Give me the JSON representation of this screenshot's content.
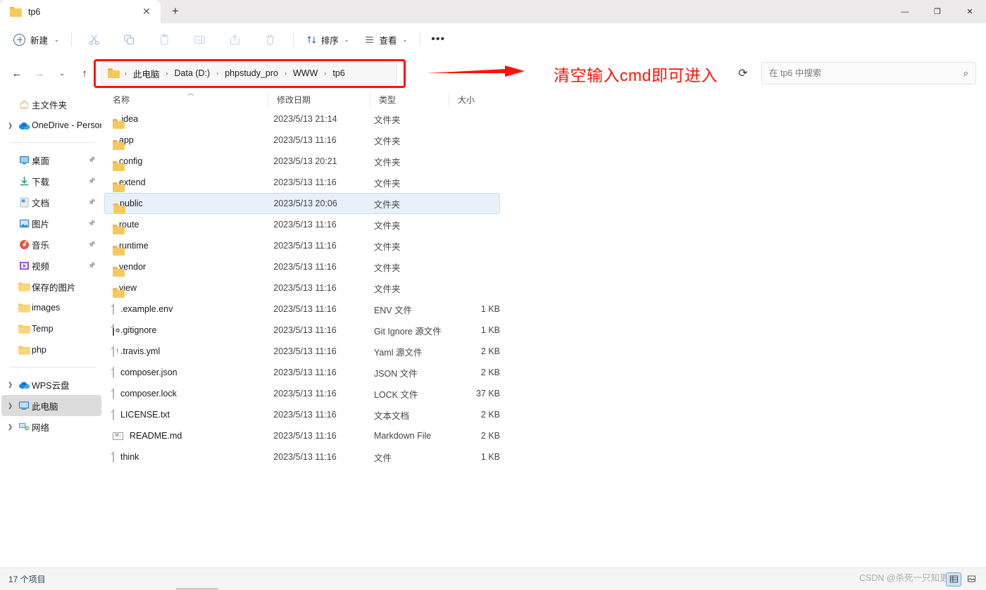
{
  "window": {
    "tab_title": "tp6",
    "tab_close_label": "✕",
    "new_tab_label": "+",
    "minimize_label": "—",
    "restore_label": "❐",
    "close_label": "✕"
  },
  "toolbar": {
    "new_label": "新建",
    "new_chevron": "⌄",
    "cut_label": "剪切",
    "copy_label": "复制",
    "paste_label": "粘贴",
    "rename_label": "重命名",
    "share_label": "共享",
    "delete_label": "删除",
    "sort_label": "排序",
    "sort_chevron": "⌄",
    "view_label": "查看",
    "view_chevron": "⌄",
    "more_label": "•••"
  },
  "navigation": {
    "back_label": "←",
    "forward_label": "→",
    "recent_label": "⌄",
    "up_label": "↑"
  },
  "breadcrumb": {
    "items": [
      "此电脑",
      "Data (D:)",
      "phpstudy_pro",
      "WWW",
      "tp6"
    ],
    "separator": "›"
  },
  "annotation": {
    "text": "清空输入cmd即可进入",
    "color": "#fc1404"
  },
  "search": {
    "placeholder": "在 tp6 中搜索",
    "value": "",
    "icon": "search-icon"
  },
  "refresh": {
    "label": "⟳"
  },
  "sidebar": {
    "items": [
      {
        "label": "主文件夹",
        "icon": "home-icon",
        "chevron": "",
        "pin": false,
        "selected": false
      },
      {
        "label": "OneDrive - Persor",
        "icon": "onedrive-icon",
        "chevron": "›",
        "pin": false,
        "selected": false
      },
      {
        "divider": true
      },
      {
        "label": "桌面",
        "icon": "desktop-icon",
        "chevron": "",
        "pin": true,
        "selected": false
      },
      {
        "label": "下载",
        "icon": "downloads-icon",
        "chevron": "",
        "pin": true,
        "selected": false
      },
      {
        "label": "文档",
        "icon": "documents-icon",
        "chevron": "",
        "pin": true,
        "selected": false
      },
      {
        "label": "图片",
        "icon": "pictures-icon",
        "chevron": "",
        "pin": true,
        "selected": false
      },
      {
        "label": "音乐",
        "icon": "music-icon",
        "chevron": "",
        "pin": true,
        "selected": false
      },
      {
        "label": "视频",
        "icon": "videos-icon",
        "chevron": "",
        "pin": true,
        "selected": false
      },
      {
        "label": "保存的图片",
        "icon": "folder-icon",
        "chevron": "",
        "pin": false,
        "selected": false
      },
      {
        "label": "images",
        "icon": "folder-icon",
        "chevron": "",
        "pin": false,
        "selected": false
      },
      {
        "label": "Temp",
        "icon": "folder-icon",
        "chevron": "",
        "pin": false,
        "selected": false
      },
      {
        "label": "php",
        "icon": "folder-icon",
        "chevron": "",
        "pin": false,
        "selected": false
      },
      {
        "divider": true
      },
      {
        "label": "WPS云盘",
        "icon": "wps-cloud-icon",
        "chevron": "›",
        "pin": false,
        "selected": false
      },
      {
        "label": "此电脑",
        "icon": "this-pc-icon",
        "chevron": "›",
        "pin": false,
        "selected": true
      },
      {
        "label": "网络",
        "icon": "network-icon",
        "chevron": "›",
        "pin": false,
        "selected": false
      }
    ]
  },
  "filelist": {
    "columns": [
      "名称",
      "修改日期",
      "类型",
      "大小"
    ],
    "sort_indicator": "︿",
    "rows": [
      {
        "name": ".idea",
        "date": "2023/5/13 21:14",
        "type": "文件夹",
        "size": "",
        "icon": "folder-icon",
        "selected": false
      },
      {
        "name": "app",
        "date": "2023/5/13 11:16",
        "type": "文件夹",
        "size": "",
        "icon": "folder-icon",
        "selected": false
      },
      {
        "name": "config",
        "date": "2023/5/13 20:21",
        "type": "文件夹",
        "size": "",
        "icon": "folder-icon",
        "selected": false
      },
      {
        "name": "extend",
        "date": "2023/5/13 11:16",
        "type": "文件夹",
        "size": "",
        "icon": "folder-icon",
        "selected": false
      },
      {
        "name": "public",
        "date": "2023/5/13 20:06",
        "type": "文件夹",
        "size": "",
        "icon": "folder-icon",
        "selected": true
      },
      {
        "name": "route",
        "date": "2023/5/13 11:16",
        "type": "文件夹",
        "size": "",
        "icon": "folder-icon",
        "selected": false
      },
      {
        "name": "runtime",
        "date": "2023/5/13 11:16",
        "type": "文件夹",
        "size": "",
        "icon": "folder-icon",
        "selected": false
      },
      {
        "name": "vendor",
        "date": "2023/5/13 11:16",
        "type": "文件夹",
        "size": "",
        "icon": "folder-icon",
        "selected": false
      },
      {
        "name": "view",
        "date": "2023/5/13 11:16",
        "type": "文件夹",
        "size": "",
        "icon": "folder-icon",
        "selected": false
      },
      {
        "name": ".example.env",
        "date": "2023/5/13 11:16",
        "type": "ENV 文件",
        "size": "1 KB",
        "icon": "file-icon",
        "selected": false
      },
      {
        "name": ".gitignore",
        "date": "2023/5/13 11:16",
        "type": "Git Ignore 源文件",
        "size": "1 KB",
        "icon": "gitignore-icon",
        "selected": false
      },
      {
        "name": ".travis.yml",
        "date": "2023/5/13 11:16",
        "type": "Yaml 源文件",
        "size": "2 KB",
        "icon": "yaml-icon",
        "selected": false
      },
      {
        "name": "composer.json",
        "date": "2023/5/13 11:16",
        "type": "JSON 文件",
        "size": "2 KB",
        "icon": "file-icon",
        "selected": false
      },
      {
        "name": "composer.lock",
        "date": "2023/5/13 11:16",
        "type": "LOCK 文件",
        "size": "37 KB",
        "icon": "file-icon",
        "selected": false
      },
      {
        "name": "LICENSE.txt",
        "date": "2023/5/13 11:16",
        "type": "文本文档",
        "size": "2 KB",
        "icon": "text-icon",
        "selected": false
      },
      {
        "name": "README.md",
        "date": "2023/5/13 11:16",
        "type": "Markdown File",
        "size": "2 KB",
        "icon": "markdown-icon",
        "selected": false
      },
      {
        "name": "think",
        "date": "2023/5/13 11:16",
        "type": "文件",
        "size": "1 KB",
        "icon": "file-icon",
        "selected": false
      }
    ]
  },
  "statusbar": {
    "item_count": "17 个项目",
    "watermark": "CSDN @杀死一只知更鸟d",
    "details_view_label": "▤",
    "large_icons_view_label": "▢"
  }
}
